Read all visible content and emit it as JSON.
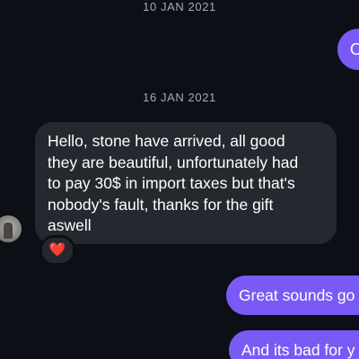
{
  "conversation": {
    "date_separators": [
      "10 JAN 2021",
      "16 JAN 2021"
    ],
    "messages": [
      {
        "direction": "outgoing",
        "text": "O",
        "partially_visible": true
      },
      {
        "direction": "incoming",
        "lines": [
          "Hello, stone have arrived, all good",
          "they are beautiful, unfortunately had",
          "to pay 30$ in import taxes but  that's",
          "nobody's fault, thanks for the gift",
          "aswell"
        ],
        "reaction": {
          "icon": "heart-icon",
          "glyph": "❤️"
        }
      },
      {
        "direction": "outgoing",
        "text": "Great sounds go",
        "partially_visible": true
      },
      {
        "direction": "outgoing",
        "text": "And its bad for y",
        "partially_visible": true
      }
    ]
  },
  "colors": {
    "background": "#0d0f17",
    "incoming_bubble": "#262830",
    "outgoing_bubble": "#7a5af5",
    "date_text": "#a6a8b3",
    "message_text": "#ffffff"
  }
}
